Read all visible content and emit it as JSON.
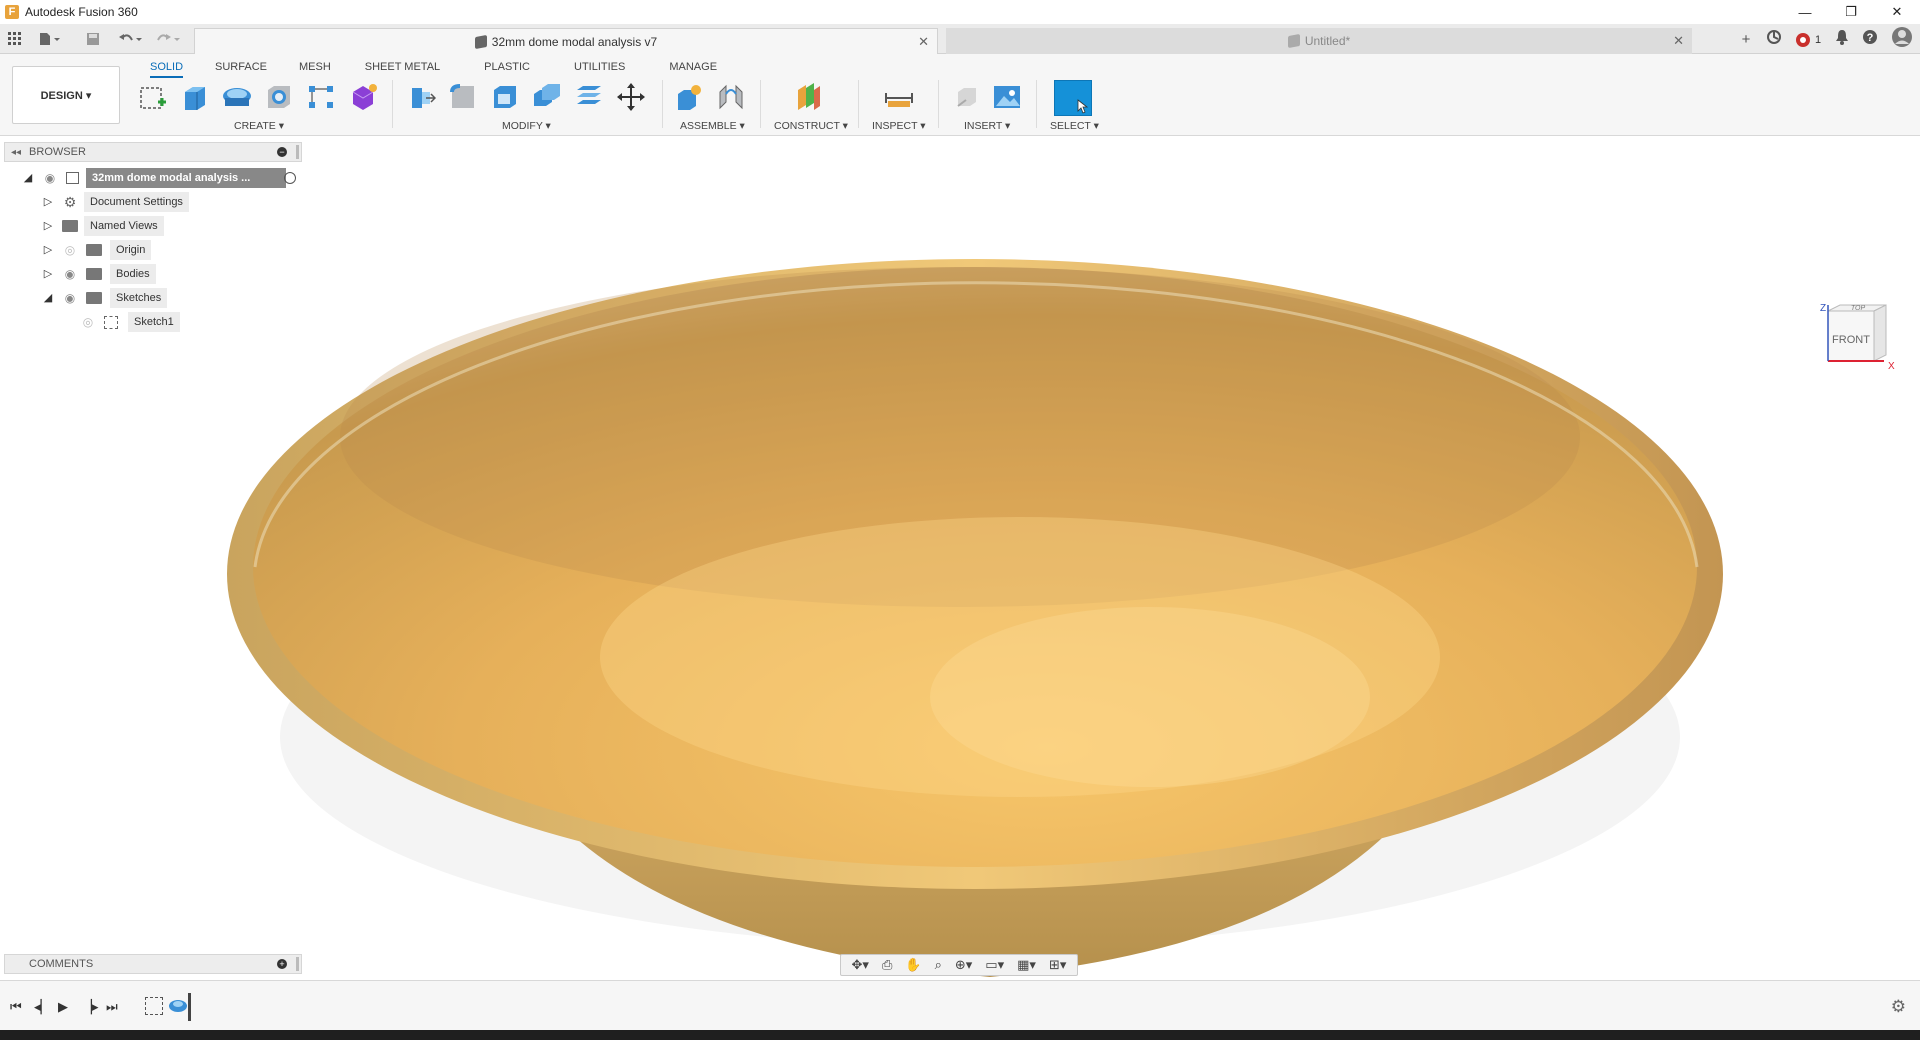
{
  "app": {
    "title": "Autodesk Fusion 360",
    "logo_letter": "F"
  },
  "window": {
    "minimize": "—",
    "restore": "❐",
    "close": "✕"
  },
  "tabs": [
    {
      "label": "32mm dome modal analysis v7",
      "active": true
    },
    {
      "label": "Untitled*",
      "active": false
    }
  ],
  "top_right": {
    "new_tab": "+",
    "notification_count": "1"
  },
  "design_button": {
    "label": "DESIGN ▾"
  },
  "mode_tabs": [
    "SOLID",
    "SURFACE",
    "MESH",
    "SHEET METAL",
    "PLASTIC",
    "UTILITIES",
    "MANAGE"
  ],
  "tool_groups": {
    "create": "CREATE ▾",
    "modify": "MODIFY ▾",
    "assemble": "ASSEMBLE ▾",
    "construct": "CONSTRUCT ▾",
    "inspect": "INSPECT ▾",
    "insert": "INSERT ▾",
    "select": "SELECT ▾"
  },
  "browser": {
    "title": "BROWSER",
    "root": "32mm dome modal analysis ...",
    "items": [
      {
        "label": "Document Settings"
      },
      {
        "label": "Named Views"
      },
      {
        "label": "Origin"
      },
      {
        "label": "Bodies"
      },
      {
        "label": "Sketches"
      },
      {
        "label": "Sketch1"
      }
    ]
  },
  "comments": {
    "title": "COMMENTS"
  },
  "viewcube": {
    "top": "TOP",
    "front": "FRONT",
    "axis_z": "Z",
    "axis_x": "X"
  },
  "colors": {
    "accent": "#0a6db8",
    "select_blue": "#1591d8",
    "dome_gold": "#e8b55a"
  }
}
